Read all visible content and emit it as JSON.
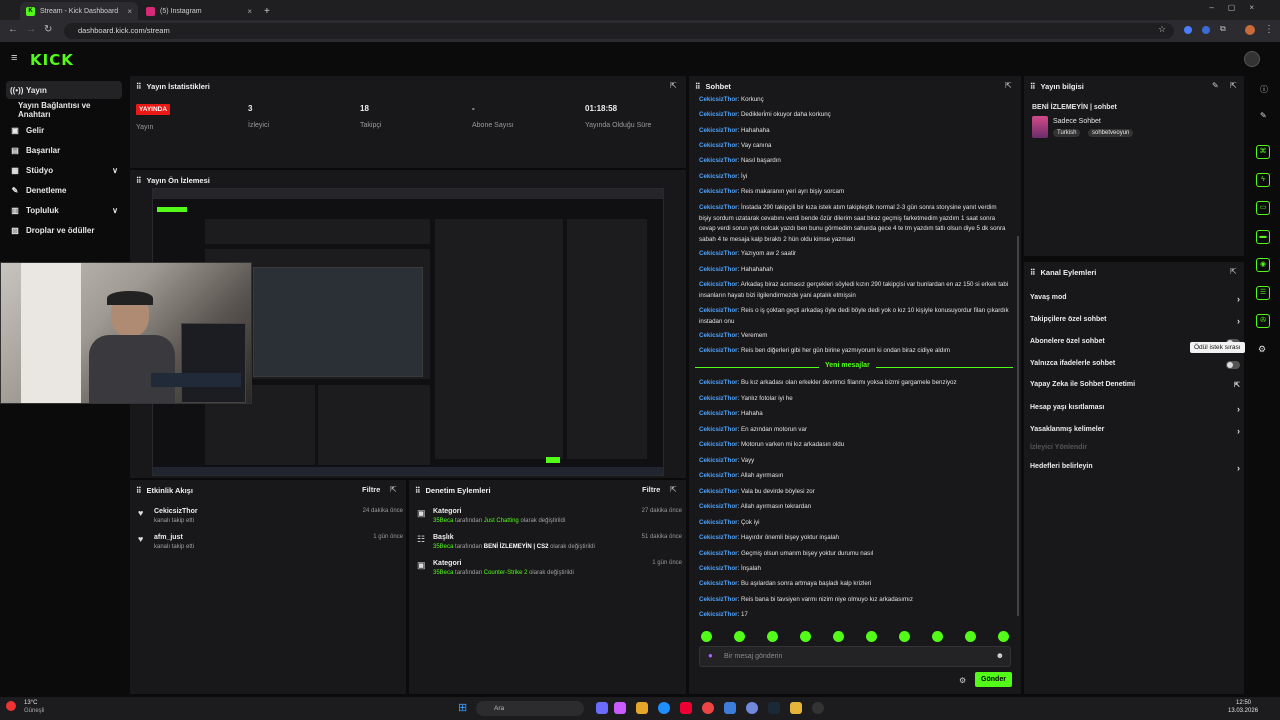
{
  "browser": {
    "tabs": [
      {
        "label": "Stream - Kick Dashboard",
        "active": true
      },
      {
        "label": "(5) Instagram",
        "active": false
      }
    ],
    "url": "dashboard.kick.com/stream",
    "new_tab": "+"
  },
  "logo": "KICK",
  "sidebar": {
    "items": [
      {
        "label": "Yayın",
        "icon": "broadcast-icon",
        "active": true
      },
      {
        "label": "Yayın Bağlantısı ve Anahtarı",
        "icon": "",
        "active": false
      },
      {
        "label": "Gelir",
        "icon": "wallet-icon"
      },
      {
        "label": "Başarılar",
        "icon": "trophy-icon"
      },
      {
        "label": "Stüdyo",
        "icon": "studio-icon",
        "chevron": "∨"
      },
      {
        "label": "Denetleme",
        "icon": "wrench-icon"
      },
      {
        "label": "Topluluk",
        "icon": "community-icon",
        "chevron": "∨"
      },
      {
        "label": "Droplar ve ödüller",
        "icon": "gift-icon"
      }
    ]
  },
  "stats": {
    "title": "Yayın İstatistikleri",
    "live_badge": "YAYINDA",
    "items": [
      {
        "value": "",
        "label": "Yayın"
      },
      {
        "value": "3",
        "label": "İzleyici"
      },
      {
        "value": "18",
        "label": "Takipçi"
      },
      {
        "value": "-",
        "label": "Abone Sayısı"
      },
      {
        "value": "01:18:58",
        "label": "Yayında Olduğu Süre"
      }
    ]
  },
  "preview": {
    "title": "Yayın Ön İzlemesi"
  },
  "activity": {
    "title": "Etkinlik Akışı",
    "filter": "Filtre",
    "items": [
      {
        "name": "CekicsizThor",
        "desc": "kanalı takip etti",
        "time": "24 dakika önce"
      },
      {
        "name": "afm_just",
        "desc": "kanalı takip etti",
        "time": "1 gün önce"
      }
    ]
  },
  "moderation": {
    "title": "Denetim Eylemleri",
    "filter": "Filtre",
    "items": [
      {
        "type": "Kategori",
        "user": "35Beca",
        "mid": "tarafından",
        "target": "Just Chatting",
        "end": "olarak değiştirildi",
        "time": "27 dakika önce"
      },
      {
        "type": "Başlık",
        "user": "35Beca",
        "mid": "tarafından",
        "target": "BENİ İZLEMEYİN | CS2",
        "end": "olarak değiştirildi",
        "time": "51 dakika önce"
      },
      {
        "type": "Kategori",
        "user": "35Beca",
        "mid": "tarafından",
        "target": "Counter-Strike 2",
        "end": "olarak değiştirildi",
        "time": "1 gün önce"
      }
    ]
  },
  "chat": {
    "title": "Sohbet",
    "username": "CekicsizThor",
    "messages_before": [
      "Korkunç",
      "Dedikleri̇mi okuyor daha korkunç",
      "Hahahaha",
      "Vay canına",
      "Nasıl başardın",
      "İyi",
      "Reis makaranın yeri ayrı bişiy sorcam",
      "İnstada 290 takipçili bir kıza istek atım takipleştik normal 2-3 gün sonra storysine yanıt verdim bişiy sordum uzatarak cevabını verdi bende özür dilerim saat biraz geçmiş farketmedim yazdım 1 saat sonra cevap verdi sorun yok nolcak yazdı ben bunu görmedim sahurda gece 4 te tm yazdım tatlı olsun diye 5 dk sonra sabah 4 te mesaja kalp bıraktı 2 hün oldu kimse yazmadı",
      "Yazıyom aw 2 saatir",
      "Hahahahah",
      "Arkadaş biraz acımasız gerçekleri söyledi kızın 290 takipçisi var bunlardan en az 150 si erkek tabi insanların hayatı bizi ilgilendirmezde yani aptalık etmişsin",
      "Reis o iş çoktan geçti arkadaş öyle dedi böyle dedi yok o kız 10 kişiyle konusuyordur filan çıkardık instadan onu",
      "Veremem",
      "Reis ben diğerleri gibi her gün birine yazmıyorum ki ondan biraz cidiye aldım"
    ],
    "new_messages_label": "Yeni mesajlar",
    "messages_after": [
      "Bu kız arkadası olan erkekler devrimci filanmı yoksa bizmi gargamele benziyoz",
      "Yanlız fotolar iyi he",
      "Hahaha",
      "En azından motorun var",
      "Motorun varken mi kız arkadasın oldu",
      "Vayy",
      "Allah ayırmasın",
      "Vala bu devirde böylesi zor",
      "Allah ayırmasın tekrardan",
      "Çok iyi",
      "Hayırdır önemli bişey yoktur inşalah",
      "Geçmiş olsun umarım bişey yoktur durumu nasıl",
      "İnşalah",
      "Bu aşılardan sonra artmaya başladı kalp krizleri",
      "Reis bana bi tavsiyen varmı nizim niye olmuyo kız arkadasımız",
      "17"
    ],
    "input_placeholder": "Bir mesaj gönderin",
    "send": "Gönder"
  },
  "info": {
    "title": "Yayın bilgisi",
    "stream_title": "BENİ İZLEMEYİN | sohbet",
    "category": "Sadece Sohbet",
    "tags": [
      "Turkish",
      "sohbetveoyun"
    ]
  },
  "channel_actions": {
    "title": "Kanal Eylemleri",
    "items": [
      {
        "label": "Yavaş mod",
        "control": "arrow"
      },
      {
        "label": "Takipçilere özel sohbet",
        "control": "arrow"
      },
      {
        "label": "Abonelere özel sohbet",
        "control": "toggle"
      },
      {
        "label": "Yalnızca ifadelerle sohbet",
        "control": "toggle"
      },
      {
        "label": "Yapay Zeka ile Sohbet Denetimi",
        "control": "external"
      },
      {
        "label": "Hesap yaşı kısıtlaması",
        "control": "arrow"
      },
      {
        "label": "Yasaklanmış kelimeler",
        "control": "arrow"
      },
      {
        "label": "İzleyici Yönlendir",
        "control": "none",
        "disabled": true
      },
      {
        "label": "Hedefleri belirleyin",
        "control": "arrow"
      }
    ]
  },
  "tooltip": "Ödül istek sırası",
  "taskbar": {
    "weather_temp": "13°C",
    "weather_desc": "Güneşli",
    "search": "Ara",
    "time": "12:50",
    "date": "13.03.2026"
  },
  "colors": {
    "accent": "#53fc18",
    "live": "#e91916",
    "username": "#4da3ff"
  }
}
